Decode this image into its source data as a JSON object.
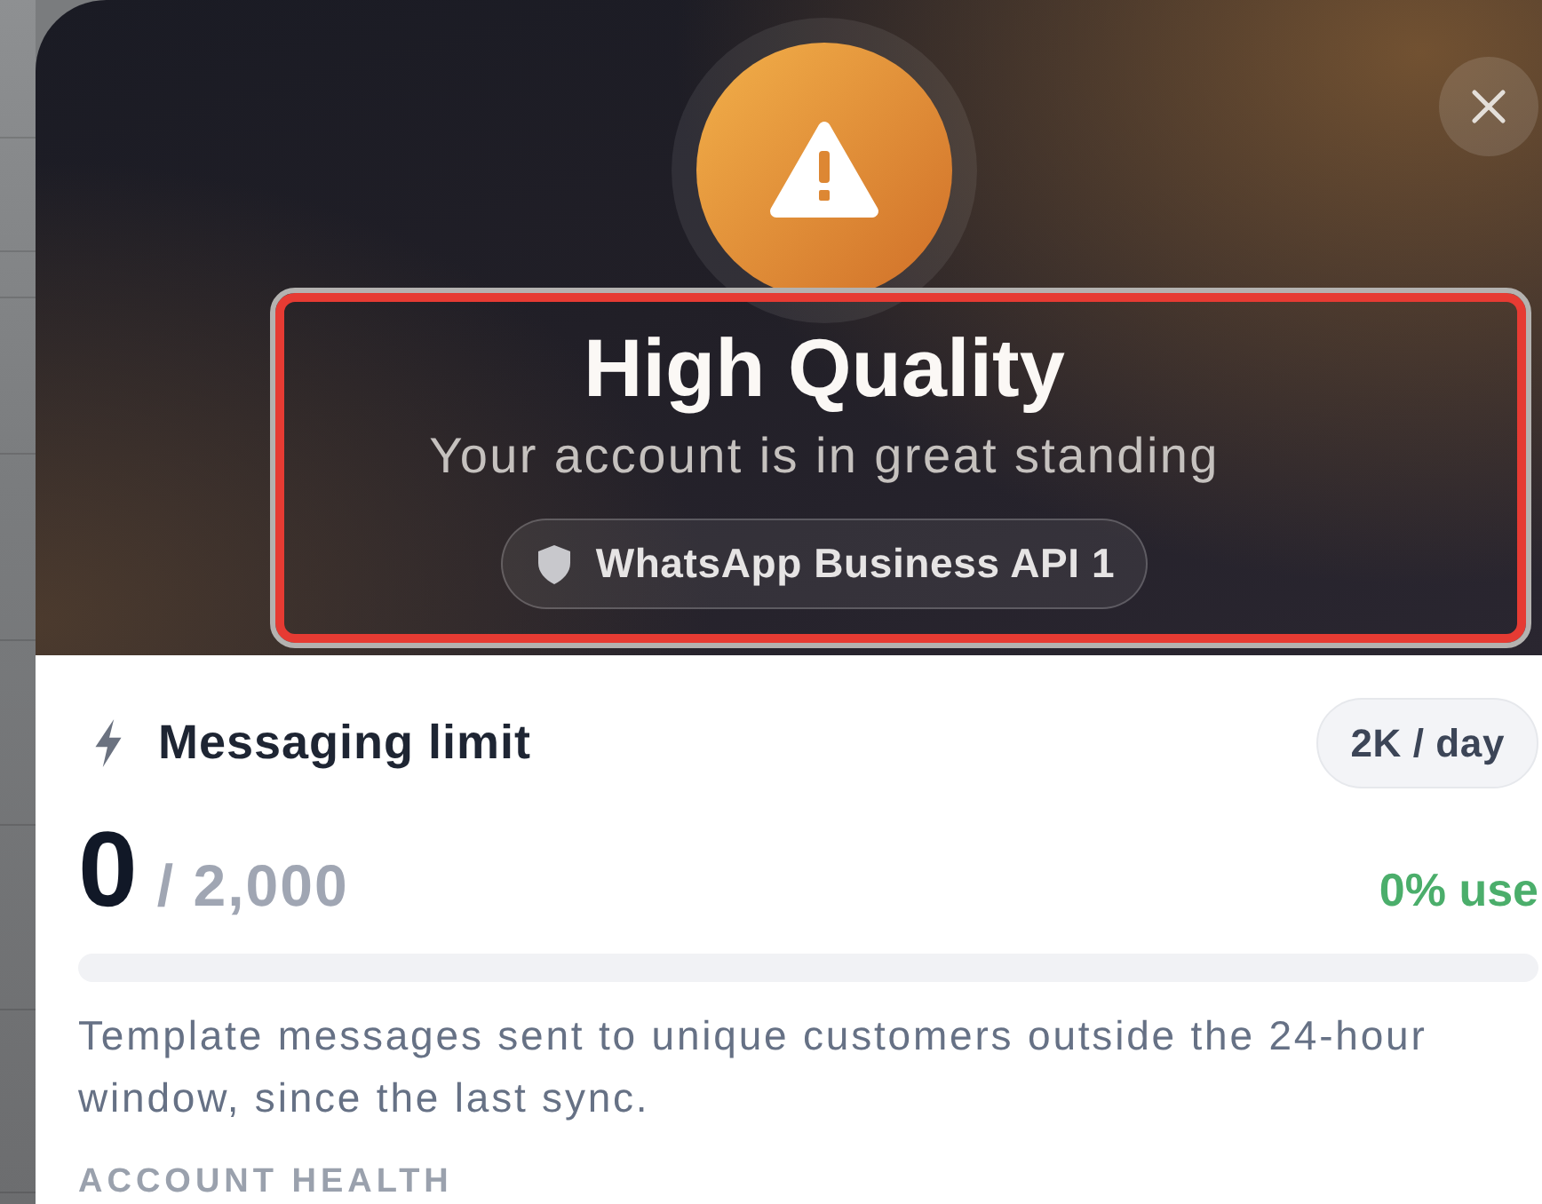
{
  "header": {
    "title": "High Quality",
    "subtitle": "Your account is in great standing",
    "badge": "WhatsApp Business API 1",
    "highlighted": true
  },
  "messaging_limit": {
    "title": "Messaging limit",
    "rate_badge": "2K / day",
    "used": "0",
    "total": "/ 2,000",
    "usage": "0% use",
    "level": 0,
    "description": "Template messages sent to unique customers outside the 24-hour window, since the last sync."
  },
  "section_heading": "ACCOUNT HEALTH"
}
